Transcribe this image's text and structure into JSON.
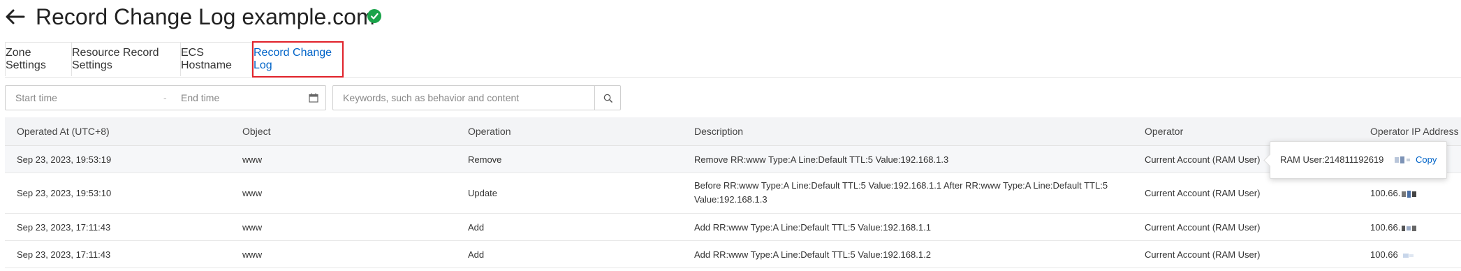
{
  "header": {
    "title": "Record Change Log example.com"
  },
  "tabs": [
    {
      "label": "Zone Settings"
    },
    {
      "label": "Resource Record Settings"
    },
    {
      "label": "ECS Hostname"
    },
    {
      "label": "Record Change Log"
    }
  ],
  "filters": {
    "start_placeholder": "Start time",
    "separator": "-",
    "end_placeholder": "End time",
    "search_placeholder": "Keywords, such as behavior and content"
  },
  "table": {
    "columns": [
      "Operated At (UTC+8)",
      "Object",
      "Operation",
      "Description",
      "Operator",
      "Operator IP Address"
    ],
    "rows": [
      {
        "time": "Sep 23, 2023, 19:53:19",
        "object": "www",
        "operation": "Remove",
        "description": "Remove RR:www Type:A Line:Default TTL:5 Value:192.168.1.3",
        "operator": "Current Account (RAM User)",
        "ip": ""
      },
      {
        "time": "Sep 23, 2023, 19:53:10",
        "object": "www",
        "operation": "Update",
        "description": "Before RR:www Type:A Line:Default TTL:5 Value:192.168.1.1 After RR:www Type:A Line:Default TTL:5 Value:192.168.1.3",
        "operator": "Current Account (RAM User)",
        "ip": "100.66."
      },
      {
        "time": "Sep 23, 2023, 17:11:43",
        "object": "www",
        "operation": "Add",
        "description": "Add RR:www Type:A Line:Default TTL:5 Value:192.168.1.1",
        "operator": "Current Account (RAM User)",
        "ip": "100.66."
      },
      {
        "time": "Sep 23, 2023, 17:11:43",
        "object": "www",
        "operation": "Add",
        "description": "Add RR:www Type:A Line:Default TTL:5 Value:192.168.1.2",
        "operator": "Current Account (RAM User)",
        "ip": "100.66"
      }
    ]
  },
  "tooltip": {
    "text": "RAM User:214811192619",
    "copy_label": "Copy"
  },
  "colors": {
    "accent": "#0064c8",
    "active_tab_border": "#e0222a",
    "verified": "#1aa34a",
    "header_bg": "#f3f4f6"
  },
  "icons": [
    "back-arrow-icon",
    "verified-icon",
    "calendar-icon",
    "search-icon"
  ]
}
